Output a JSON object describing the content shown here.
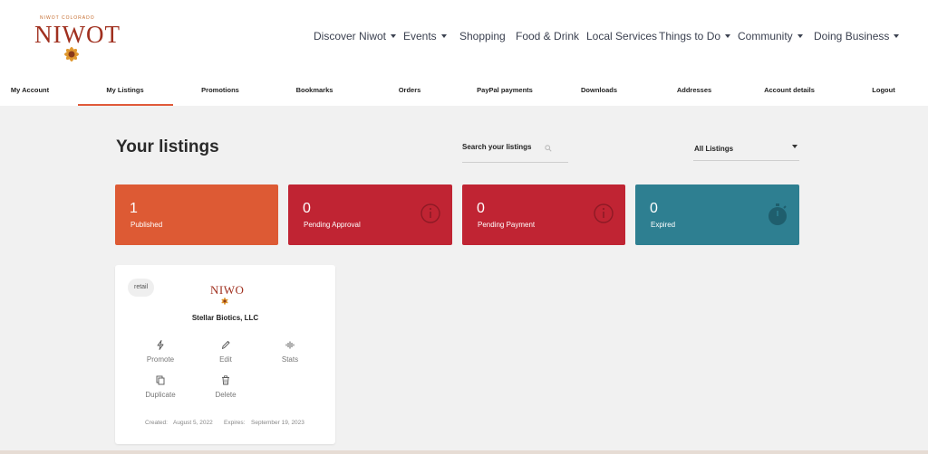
{
  "logo": {
    "tagline": "NIWOT COLORADO",
    "wordmark": "NIWOT"
  },
  "main_nav": [
    {
      "label": "Discover Niwot",
      "dropdown": true
    },
    {
      "label": "Events",
      "dropdown": true
    },
    {
      "label": "Shopping",
      "dropdown": false
    },
    {
      "label": "Food & Drink",
      "dropdown": false
    },
    {
      "label": "Local Services",
      "dropdown": false
    },
    {
      "label": "Things to Do",
      "dropdown": true
    },
    {
      "label": "Community",
      "dropdown": true
    },
    {
      "label": "Doing Business",
      "dropdown": true
    }
  ],
  "account_nav": [
    {
      "label": "My Account"
    },
    {
      "label": "My Listings",
      "active": true
    },
    {
      "label": "Promotions"
    },
    {
      "label": "Bookmarks"
    },
    {
      "label": "Orders"
    },
    {
      "label": "PayPal payments"
    },
    {
      "label": "Downloads"
    },
    {
      "label": "Addresses"
    },
    {
      "label": "Account details"
    },
    {
      "label": "Logout"
    }
  ],
  "page": {
    "title": "Your listings",
    "search_placeholder": "Search your listings",
    "filter_selected": "All Listings"
  },
  "stats": [
    {
      "count": "1",
      "label": "Published",
      "color": "#dd5a34",
      "icon": "none"
    },
    {
      "count": "0",
      "label": "Pending Approval",
      "color": "#c02433",
      "icon": "info-circle-icon"
    },
    {
      "count": "0",
      "label": "Pending Payment",
      "color": "#c02433",
      "icon": "info-circle-icon"
    },
    {
      "count": "0",
      "label": "Expired",
      "color": "#2e7f91",
      "icon": "stopwatch-icon"
    }
  ],
  "listing": {
    "badge": "retail",
    "logo_text": "NIWO",
    "name": "Stellar Biotics, LLC",
    "actions": {
      "promote": "Promote",
      "edit": "Edit",
      "stats": "Stats",
      "duplicate": "Duplicate",
      "delete": "Delete"
    },
    "created_label": "Created:",
    "created_value": "August 5, 2022",
    "expires_label": "Expires:",
    "expires_value": "September 19, 2023"
  },
  "colors": {
    "accent": "#e05a3a",
    "nav_text": "#3b4150",
    "page_bg": "#f1f1f1"
  }
}
